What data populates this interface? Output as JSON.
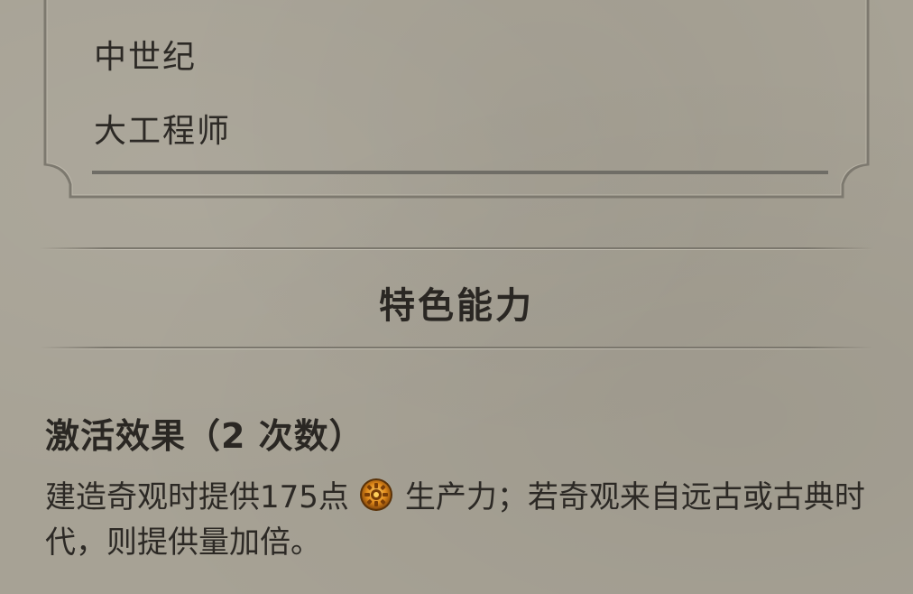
{
  "card": {
    "items": [
      "中世纪",
      "大工程师"
    ]
  },
  "section": {
    "title": "特色能力"
  },
  "ability": {
    "title": "激活效果（2 次数）",
    "desc_before_icon": "建造奇观时提供175点",
    "icon": "production-icon",
    "desc_after_icon": "生产力；若奇观来自远古或古典时代，则提供量加倍。"
  },
  "colors": {
    "background": "#a7a295",
    "text": "#2a2723",
    "frame": "#7b776d",
    "production_icon": "#e08a1a"
  }
}
